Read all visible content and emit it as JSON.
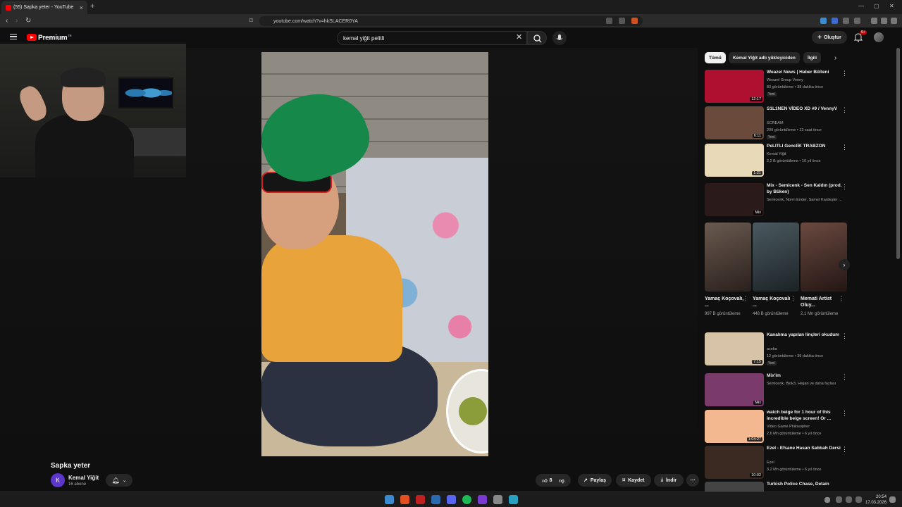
{
  "browser": {
    "tab_title": "(55) Sapka yeter - YouTube",
    "url": "youtube.com/watch?v=hkSLACER0YA"
  },
  "header": {
    "brand": "Premium",
    "brand_sup": "TR",
    "search_value": "kemal yiğit pelitli",
    "create_label": "Oluştur",
    "notif_count": "9+"
  },
  "video": {
    "title": "Sapka yeter",
    "channel": "Kemal Yiğit",
    "channel_initial": "K",
    "subscribers": "16 abone",
    "likes": "8",
    "share_label": "Paylaş",
    "save_label": "Kaydet",
    "download_label": "İndir"
  },
  "chips": [
    "Tümü",
    "Kemal Yiğit adlı yükleyiciden",
    "İlgili"
  ],
  "recs": [
    {
      "title": "Weazel News | Haber Bülteni",
      "channel": "Weazel Group Venny",
      "meta": "83 görüntüleme • 38 dakika önce",
      "badge": "Yeni",
      "duration": "12:17",
      "thumb": "#b01030"
    },
    {
      "title": "S1L1NEN VİDEO XD #9 / VennyV",
      "channel": "SCREAM",
      "meta": "209 görüntüleme • 13 saat önce",
      "badge": "Yeni",
      "duration": "6:11",
      "thumb": "#6a4a3a"
    },
    {
      "title": "PeLITLI Gencli̇K TRABZON",
      "channel": "Kemal Yiğit",
      "meta": "2,2 B görüntüleme • 10 yıl önce",
      "badge": "",
      "duration": "1:21",
      "thumb": "#e8d9b8"
    },
    {
      "title": "Mix - Semicenk - Sen Kaldın (prod. by Büken)",
      "channel": "Semicenk, Norm Ender, Samet Kardeşler ...",
      "meta": "",
      "badge": "",
      "duration": "Mix",
      "thumb": "#2a1a1a"
    },
    {
      "title": "Kanalıma yapılan linçleri okudum",
      "channel": "aceka",
      "meta": "12 görüntüleme • 39 dakika önce",
      "badge": "Yeni",
      "duration": "7:15",
      "thumb": "#d7c3a8"
    },
    {
      "title": "Mix'im",
      "channel": "Semicenk, Blok3, Heijan ve daha fazlası",
      "meta": "",
      "badge": "",
      "duration": "Mix",
      "thumb": "#7a3a6a"
    },
    {
      "title": "watch beige for 1 hour of this incredible beige screen! Or ...",
      "channel": "Video Game Philosopher",
      "meta": "2,6 Mn görüntüleme • 6 yıl önce",
      "badge": "",
      "duration": "1:04:27",
      "thumb": "#f4b890"
    },
    {
      "title": "Ezel - Efsane Hasan Sabbah Dersi",
      "channel": "Ezel",
      "meta": "3,2 Mn görüntüleme • 6 yıl önce",
      "badge": "",
      "duration": "10:02",
      "thumb": "#3a2a22"
    },
    {
      "title": "Turkish Police Chase, Detain",
      "channel": "",
      "meta": "",
      "badge": "",
      "duration": "",
      "thumb": "#444"
    }
  ],
  "shorts": [
    {
      "title": "Yamaç Koçovalı, ...",
      "views": "997 B görüntüleme",
      "thumb": "#5a4a40"
    },
    {
      "title": "Yamaç Koçovalı ...",
      "views": "448 B görüntüleme",
      "thumb": "#3e4a50"
    },
    {
      "title": "Memati Artist Oluy...",
      "views": "2,1 Mn görüntüleme",
      "thumb": "#5a3a30"
    }
  ],
  "taskbar": {
    "time": "20:54",
    "date": "17.03.2026"
  }
}
